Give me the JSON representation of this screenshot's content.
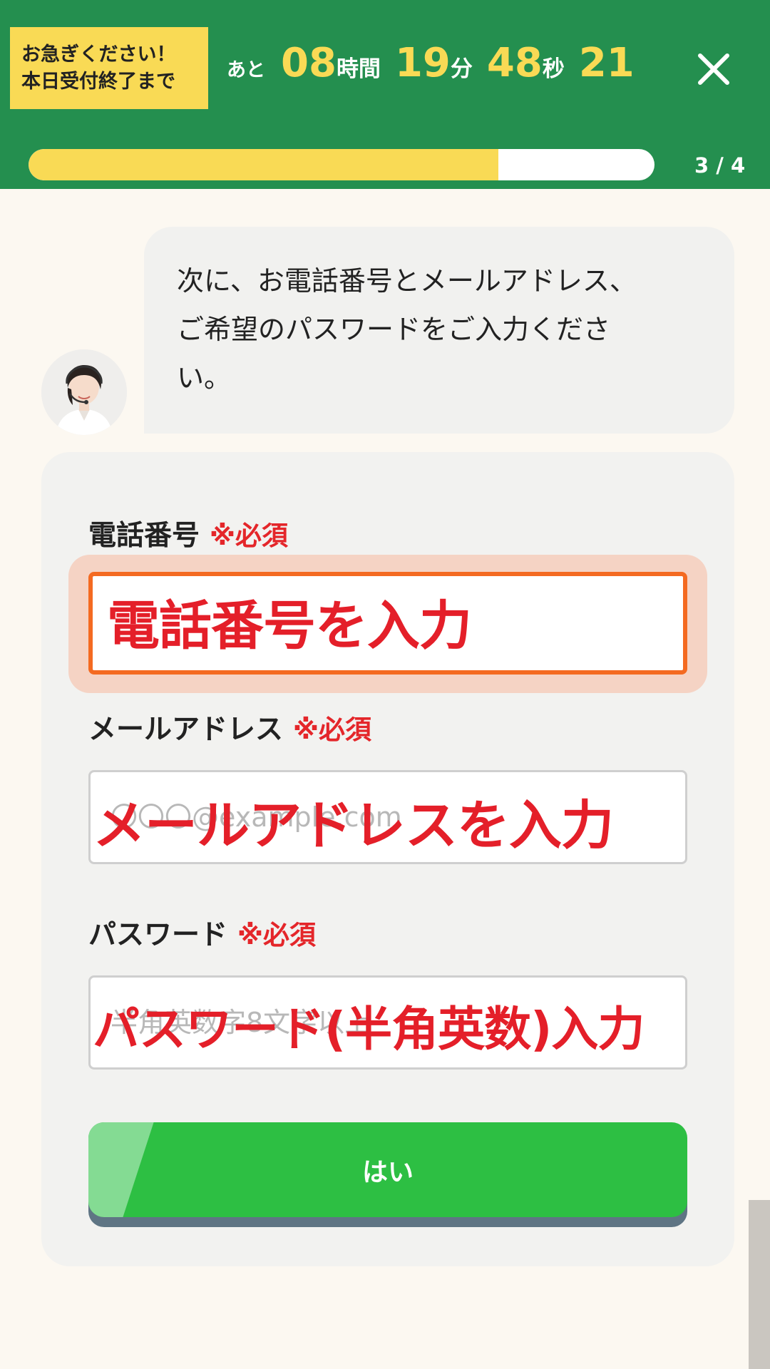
{
  "header": {
    "urgent_line1": "お急ぎください！",
    "urgent_line2": "本日受付終了まで",
    "timer_prefix": "あと",
    "hours": "08",
    "hours_unit": "時間",
    "minutes": "19",
    "minutes_unit": "分",
    "seconds": "48",
    "seconds_unit": "秒",
    "fraction": "21",
    "progress_fraction": 0.75,
    "step_text": "3 / 4"
  },
  "chat": {
    "message_line1": "次に、お電話番号とメールアドレス、",
    "message_line2": "ご希望のパスワードをご入力くださ",
    "message_line3": "い。"
  },
  "form": {
    "phone": {
      "label": "電話番号",
      "required": "※必須",
      "placeholder": "",
      "overlay": "電話番号を入力"
    },
    "email": {
      "label": "メールアドレス",
      "required": "※必須",
      "placeholder": "〇〇〇@example.com",
      "overlay": "メールアドレスを入力"
    },
    "password": {
      "label": "パスワード",
      "required": "※必須",
      "placeholder": "半角英数字8文字以上",
      "overlay": "パスワード(半角英数)入力"
    },
    "submit_label": "はい"
  },
  "colors": {
    "header_green": "#248f4f",
    "accent_yellow": "#f9da55",
    "required_red": "#e4262a",
    "focus_orange": "#f46a21",
    "button_green": "#2dbf43"
  },
  "icons": {
    "close": "close-icon",
    "avatar": "operator-avatar"
  }
}
